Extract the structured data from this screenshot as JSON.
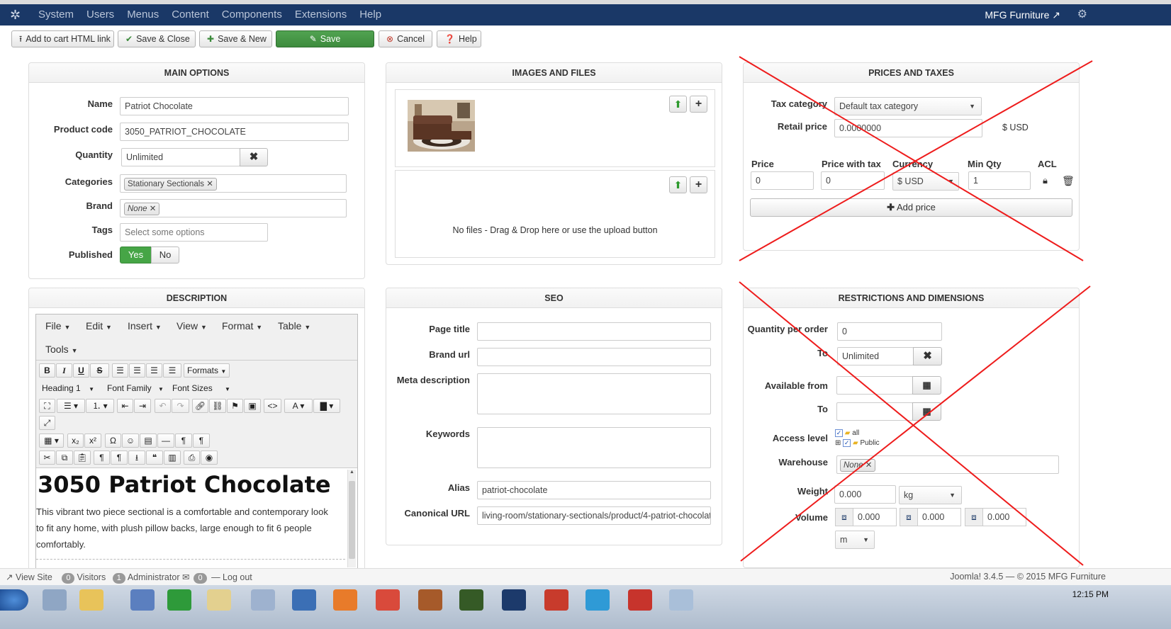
{
  "topmenu": {
    "items": [
      "System",
      "Users",
      "Menus",
      "Content",
      "Components",
      "Extensions",
      "Help"
    ],
    "site_name": "MFG Furniture"
  },
  "toolbar": {
    "add_to_cart": "Add to cart HTML link",
    "save_close": "Save & Close",
    "save_new": "Save & New",
    "save": "Save",
    "cancel": "Cancel",
    "help": "Help"
  },
  "main_options": {
    "title": "MAIN OPTIONS",
    "name_label": "Name",
    "name_value": "Patriot Chocolate",
    "code_label": "Product code",
    "code_value": "3050_PATRIOT_CHOCOLATE",
    "qty_label": "Quantity",
    "qty_value": "Unlimited",
    "categories_label": "Categories",
    "category_chip": "Stationary Sectionals",
    "brand_label": "Brand",
    "brand_chip": "None",
    "tags_label": "Tags",
    "tags_placeholder": "Select some options",
    "published_label": "Published",
    "yes": "Yes",
    "no": "No"
  },
  "images": {
    "title": "IMAGES AND FILES",
    "no_files": "No files - Drag & Drop here or use the upload button"
  },
  "prices": {
    "title": "PRICES AND TAXES",
    "tax_label": "Tax category",
    "tax_value": "Default tax category",
    "retail_label": "Retail price",
    "retail_value": "0.0000000",
    "retail_currency": "$ USD",
    "col_price": "Price",
    "col_price_tax": "Price with tax",
    "col_currency": "Currency",
    "col_min_qty": "Min Qty",
    "col_acl": "ACL",
    "price_value": "0",
    "price_tax_value": "0",
    "currency_value": "$ USD",
    "min_qty_value": "1",
    "add_price": "Add price"
  },
  "description": {
    "title": "DESCRIPTION",
    "menus": [
      "File",
      "Edit",
      "Insert",
      "View",
      "Format",
      "Table"
    ],
    "tools": "Tools",
    "formats": "Formats",
    "heading": "Heading 1",
    "font_family": "Font Family",
    "font_sizes": "Font Sizes",
    "content_heading": "3050 Patriot Chocolate",
    "content_lines": [
      "This vibrant two piece sectional is a comfortable and contemporary look",
      "to fit any home, with plush pillow backs, large enough to fit 6 people",
      "comfortably."
    ]
  },
  "seo": {
    "title": "SEO",
    "page_title": "Page title",
    "brand_url": "Brand url",
    "meta_desc": "Meta description",
    "keywords": "Keywords",
    "alias_label": "Alias",
    "alias_value": "patriot-chocolate",
    "canonical_label": "Canonical URL",
    "canonical_value": "living-room/stationary-sectionals/product/4-patriot-chocolat"
  },
  "restrictions": {
    "title": "RESTRICTIONS AND DIMENSIONS",
    "qpo_label": "Quantity per order",
    "qpo_value": "0",
    "to_label": "To",
    "to_value": "Unlimited",
    "avail_label": "Available from",
    "to2_label": "To",
    "access_label": "Access level",
    "access_all": "all",
    "access_public": "Public",
    "warehouse_label": "Warehouse",
    "warehouse_chip": "None",
    "weight_label": "Weight",
    "weight_value": "0.000",
    "weight_unit": "kg",
    "volume_label": "Volume",
    "vol1": "0.000",
    "vol2": "0.000",
    "vol3": "0.000",
    "vol_unit": "m"
  },
  "footer": {
    "view_site": "View Site",
    "visitors_count": "0",
    "visitors": "Visitors",
    "admin_count": "1",
    "admin": "Administrator",
    "msg_count": "0",
    "logout": "Log out",
    "version": "Joomla! 3.4.5 — © 2015 MFG Furniture"
  },
  "taskbar": {
    "clock": "12:15 PM"
  },
  "colors": {
    "topbar": "#1a3867",
    "save_green": "#46a546",
    "cross_red": "#ee1c1c"
  }
}
